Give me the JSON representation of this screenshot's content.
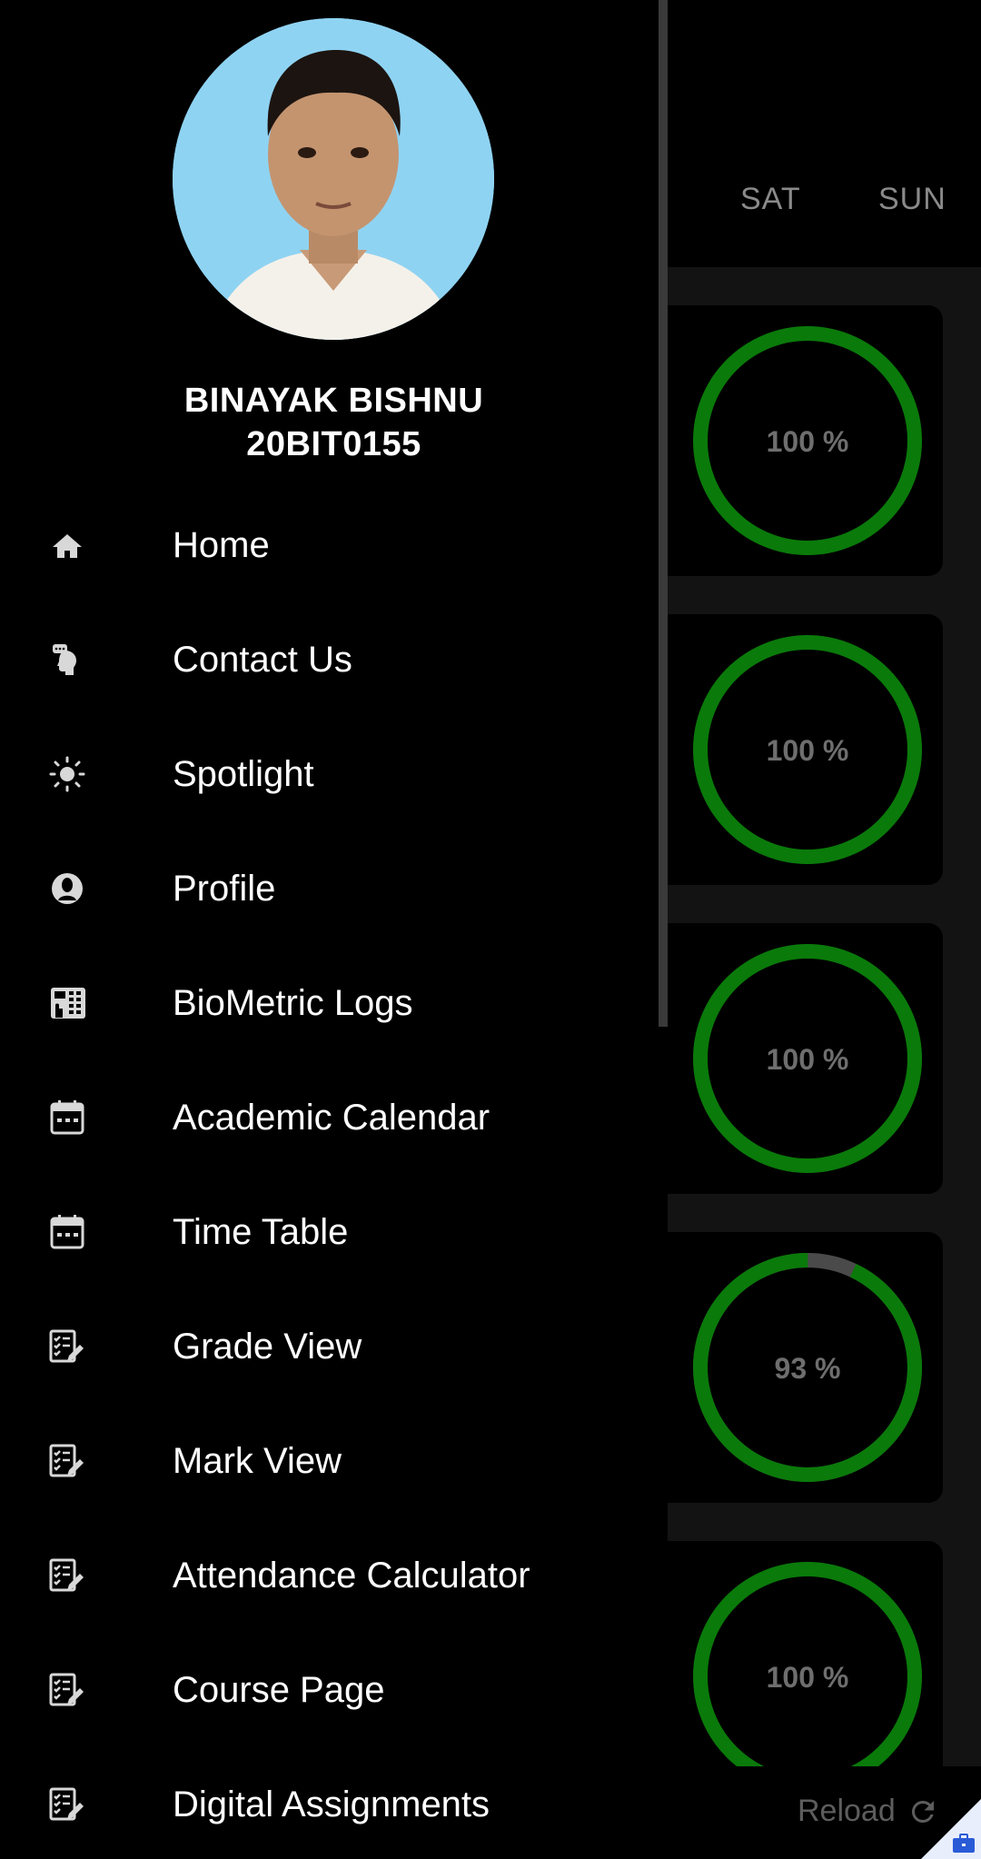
{
  "days": [
    "SAT",
    "SUN"
  ],
  "attendance_cards": [
    {
      "label": "100 %",
      "percent": 100
    },
    {
      "label": "100 %",
      "percent": 100
    },
    {
      "label": "100 %",
      "percent": 100
    },
    {
      "label": "93 %",
      "percent": 93
    },
    {
      "label": "100 %",
      "percent": 100
    }
  ],
  "reload_label": "Reload",
  "user": {
    "name": "BINAYAK BISHNU",
    "id": "20BIT0155"
  },
  "menu": [
    {
      "label": "Home",
      "icon": "home-icon"
    },
    {
      "label": "Contact Us",
      "icon": "contact-support-icon"
    },
    {
      "label": "Spotlight",
      "icon": "sun-icon"
    },
    {
      "label": "Profile",
      "icon": "profile-icon"
    },
    {
      "label": "BioMetric Logs",
      "icon": "biometric-device-icon"
    },
    {
      "label": "Academic Calendar",
      "icon": "calendar-icon"
    },
    {
      "label": "Time Table",
      "icon": "calendar-icon"
    },
    {
      "label": "Grade View",
      "icon": "checklist-edit-icon"
    },
    {
      "label": "Mark View",
      "icon": "checklist-edit-icon"
    },
    {
      "label": "Attendance Calculator",
      "icon": "checklist-edit-icon"
    },
    {
      "label": "Course Page",
      "icon": "checklist-edit-icon"
    },
    {
      "label": "Digital Assignments",
      "icon": "checklist-edit-icon"
    }
  ],
  "colors": {
    "ring_full": "#0a7a0a",
    "ring_track": "#4a4a4a",
    "drawer_bg": "#000000",
    "text": "#ffffff"
  }
}
